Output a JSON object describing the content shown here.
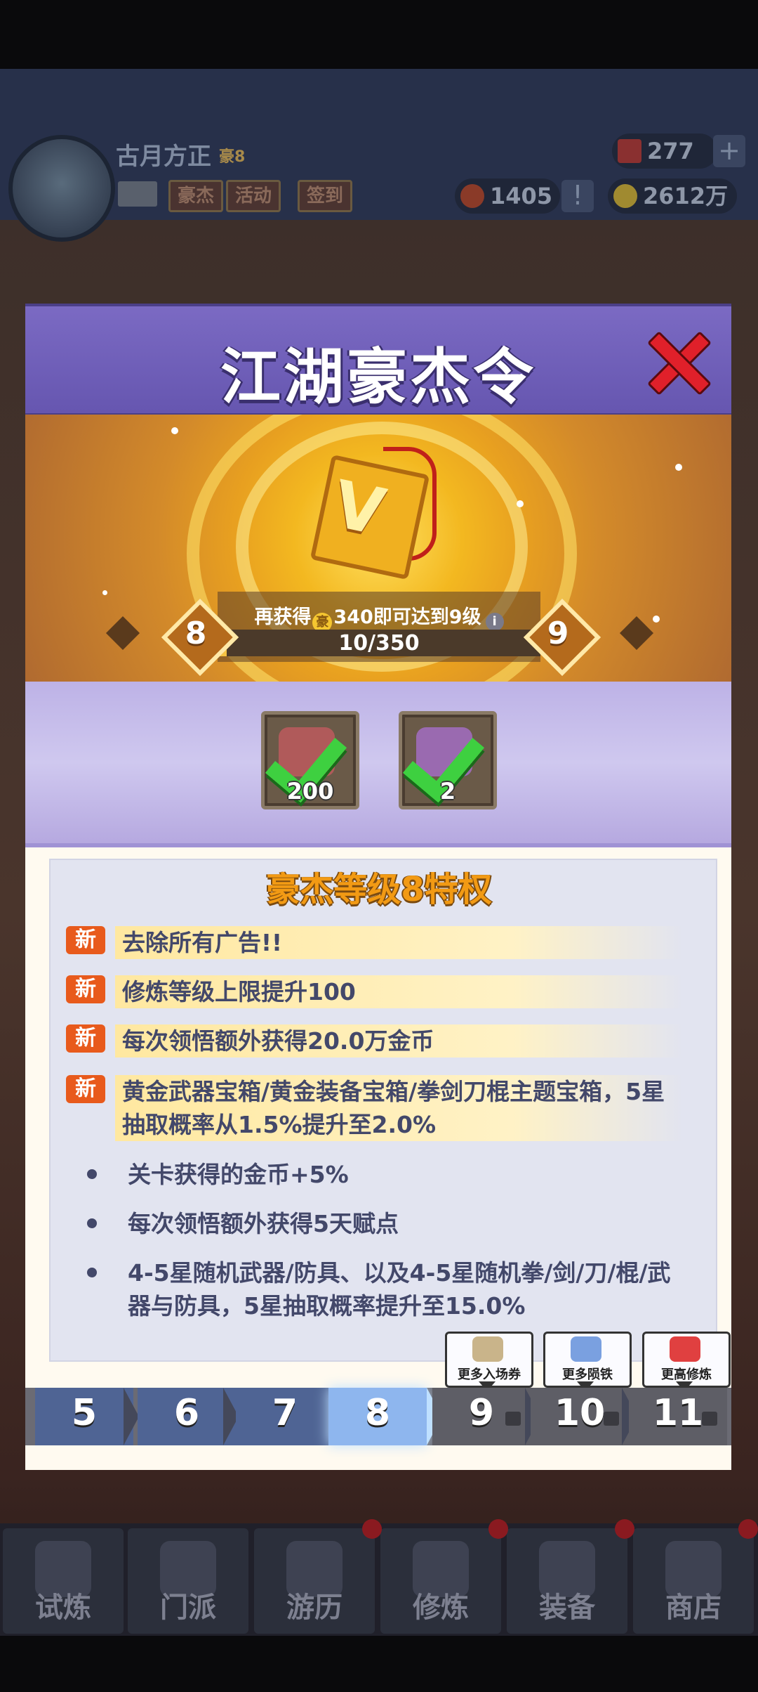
{
  "background": {
    "player_name": "古月方正",
    "player_rank": "豪8",
    "header_buttons": [
      "豪杰",
      "活动",
      "签到"
    ],
    "ruby": "277",
    "medal": "1405",
    "gold": "2612万",
    "plus_label": "+",
    "alert_label": "!",
    "bottom_tabs": [
      "试炼",
      "门派",
      "游历",
      "修炼",
      "装备",
      "商店"
    ]
  },
  "modal": {
    "title": "江湖豪杰令",
    "close_icon": "close-icon",
    "progress": {
      "prefix": "再获得",
      "coin_glyph": "豪",
      "suffix": "340即可达到9级",
      "info_glyph": "i",
      "current": 10,
      "max": 350,
      "text": "10/350",
      "level_from": "8",
      "level_to": "9"
    },
    "rewards": [
      {
        "icon": "ruby-icon",
        "count": "200",
        "claimed": true,
        "color": "#b05a5a"
      },
      {
        "icon": "token-icon",
        "count": "2",
        "claimed": true,
        "color": "#9a6ab0"
      }
    ],
    "privileges": {
      "title": "豪杰等级8特权",
      "new_label": "新",
      "new_items": [
        "去除所有广告!!",
        "修炼等级上限提升100",
        "每次领悟额外获得20.0万金币",
        "黄金武器宝箱/黄金装备宝箱/拳剑刀棍主题宝箱，5星抽取概率从1.5%提升至2.0%"
      ],
      "items": [
        "关卡获得的金币+5%",
        "每次领悟额外获得5天赋点",
        "4-5星随机武器/防具、以及4-5星随机拳/剑/刀/棍/武器与防具，5星抽取概率提升至15.0%"
      ]
    },
    "tiers": [
      {
        "label": "5",
        "state": "past"
      },
      {
        "label": "6",
        "state": "past"
      },
      {
        "label": "7",
        "state": "past"
      },
      {
        "label": "8",
        "state": "current"
      },
      {
        "label": "9",
        "state": "locked"
      },
      {
        "label": "10",
        "state": "locked"
      },
      {
        "label": "11",
        "state": "locked"
      }
    ],
    "tier_bonuses": [
      {
        "label": "更多入场券",
        "icon": "ticket-icon",
        "color": "#c9b48a"
      },
      {
        "label": "更多陨铁",
        "icon": "meteor-iron-icon",
        "color": "#7aa0e0"
      },
      {
        "label": "更高修炼",
        "icon": "heart-sword-icon",
        "color": "#e04040"
      }
    ]
  },
  "colors": {
    "title_bar": "#6656b0",
    "accent_gold": "#f29a14",
    "new_tag": "#e85a1c",
    "close_red": "#e0202a"
  }
}
